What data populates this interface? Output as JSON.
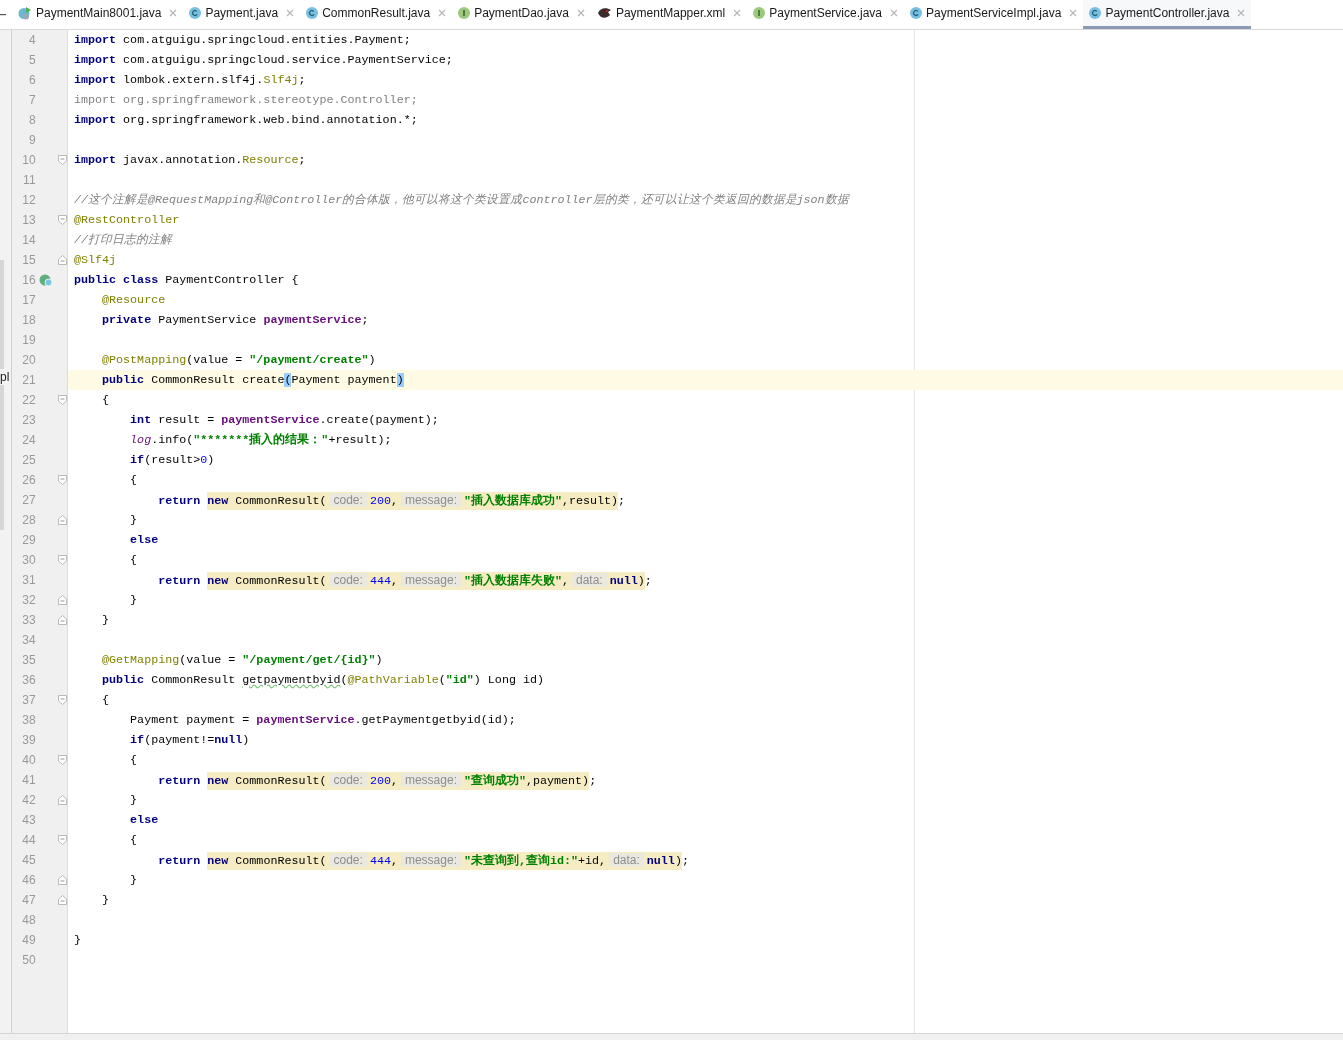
{
  "tab_bar": {
    "tabs": [
      {
        "label": "PaymentMain8001.java",
        "kind": "main",
        "selected": false
      },
      {
        "label": "Payment.java",
        "kind": "class",
        "selected": false
      },
      {
        "label": "CommonResult.java",
        "kind": "class",
        "selected": false
      },
      {
        "label": "PaymentDao.java",
        "kind": "interface",
        "selected": false
      },
      {
        "label": "PaymentMapper.xml",
        "kind": "mapper",
        "selected": false
      },
      {
        "label": "PaymentService.java",
        "kind": "interface",
        "selected": false
      },
      {
        "label": "PaymentServiceImpl.java",
        "kind": "class",
        "selected": false
      },
      {
        "label": "PaymentController.java",
        "kind": "class",
        "selected": true
      }
    ]
  },
  "side_panel": {
    "text": "pl"
  },
  "editor": {
    "lines": [
      {
        "number": "4",
        "current": false,
        "tokens": [
          {
            "kind": "kw",
            "text": "import"
          },
          {
            "kind": "plain",
            "text": " com.atguigu.springcloud.entities.Payment;"
          }
        ]
      },
      {
        "number": "5",
        "current": false,
        "tokens": [
          {
            "kind": "kw",
            "text": "import"
          },
          {
            "kind": "plain",
            "text": " com.atguigu.springcloud.service.PaymentService;"
          }
        ]
      },
      {
        "number": "6",
        "current": false,
        "tokens": [
          {
            "kind": "kw",
            "text": "import"
          },
          {
            "kind": "plain",
            "text": " lombok.extern.slf4j."
          },
          {
            "kind": "ann",
            "text": "Slf4j"
          },
          {
            "kind": "plain",
            "text": ";"
          }
        ]
      },
      {
        "number": "7",
        "current": false,
        "tokens": [
          {
            "kind": "unused",
            "text": "import org.springframework.stereotype.Controller;"
          }
        ]
      },
      {
        "number": "8",
        "current": false,
        "tokens": [
          {
            "kind": "kw",
            "text": "import"
          },
          {
            "kind": "plain",
            "text": " org.springframework.web.bind.annotation.*;"
          }
        ]
      },
      {
        "number": "9",
        "current": false
      },
      {
        "number": "10",
        "current": false,
        "fold": {
          "kind": "start"
        },
        "tokens": [
          {
            "kind": "kw",
            "text": "import"
          },
          {
            "kind": "plain",
            "text": " javax.annotation."
          },
          {
            "kind": "ann",
            "text": "Resource"
          },
          {
            "kind": "plain",
            "text": ";"
          }
        ]
      },
      {
        "number": "11",
        "current": false
      },
      {
        "number": "12",
        "current": false,
        "tokens": [
          {
            "kind": "comment",
            "text": "//这个注解是@RequestMapping和@Controller的合体版，他可以将这个类设置成controller层的类，还可以让这个类返回的数据是json数据"
          }
        ]
      },
      {
        "number": "13",
        "current": false,
        "fold": {
          "kind": "start"
        },
        "tokens": [
          {
            "kind": "ann",
            "text": "@RestController"
          }
        ]
      },
      {
        "number": "14",
        "current": false,
        "tokens": [
          {
            "kind": "comment",
            "text": "//打印日志的注解"
          }
        ]
      },
      {
        "number": "15",
        "current": false,
        "fold": {
          "kind": "end"
        },
        "tokens": [
          {
            "kind": "ann",
            "text": "@Slf4j"
          }
        ]
      },
      {
        "number": "16",
        "current": false,
        "gutter_icon": {
          "kind": "run"
        },
        "tokens": [
          {
            "kind": "kw",
            "text": "public class"
          },
          {
            "kind": "plain",
            "text": " PaymentController {"
          }
        ]
      },
      {
        "number": "17",
        "current": false,
        "tokens": [
          {
            "kind": "ann",
            "text": "    @Resource"
          }
        ]
      },
      {
        "number": "18",
        "current": false,
        "tokens": [
          {
            "kind": "kw",
            "text": "    private"
          },
          {
            "kind": "plain",
            "text": " PaymentService "
          },
          {
            "kind": "field",
            "text": "paymentService"
          },
          {
            "kind": "plain",
            "text": ";"
          }
        ]
      },
      {
        "number": "19",
        "current": false
      },
      {
        "number": "20",
        "current": false,
        "tokens": [
          {
            "kind": "ann",
            "text": "    @PostMapping"
          },
          {
            "kind": "plain",
            "text": "(value = "
          },
          {
            "kind": "str",
            "text": "\"/payment/create\""
          },
          {
            "kind": "plain",
            "text": ")"
          }
        ]
      },
      {
        "number": "21",
        "current": true,
        "tokens": [
          {
            "kind": "kw",
            "text": "    public"
          },
          {
            "kind": "plain",
            "text": " CommonResult create"
          },
          {
            "kind": "match",
            "text": "("
          },
          {
            "kind": "plain",
            "text": "Payment payment"
          },
          {
            "kind": "match",
            "text": ")"
          }
        ]
      },
      {
        "number": "22",
        "current": false,
        "fold": {
          "kind": "start"
        },
        "tokens": [
          {
            "kind": "plain",
            "text": "    {"
          }
        ]
      },
      {
        "number": "23",
        "current": false,
        "tokens": [
          {
            "kind": "kw",
            "text": "        int"
          },
          {
            "kind": "plain",
            "text": " result = "
          },
          {
            "kind": "field",
            "text": "paymentService"
          },
          {
            "kind": "plain",
            "text": ".create(payment);"
          }
        ]
      },
      {
        "number": "24",
        "current": false,
        "tokens": [
          {
            "kind": "static",
            "text": "        log"
          },
          {
            "kind": "plain",
            "text": ".info("
          },
          {
            "kind": "str",
            "text": "\"*******插入的结果：\""
          },
          {
            "kind": "plain",
            "text": "+result);"
          }
        ]
      },
      {
        "number": "25",
        "current": false,
        "tokens": [
          {
            "kind": "kw",
            "text": "        if"
          },
          {
            "kind": "plain",
            "text": "(result>"
          },
          {
            "kind": "num",
            "text": "0"
          },
          {
            "kind": "plain",
            "text": ")"
          }
        ]
      },
      {
        "number": "26",
        "current": false,
        "fold": {
          "kind": "start"
        },
        "tokens": [
          {
            "kind": "plain",
            "text": "        {"
          }
        ]
      },
      {
        "number": "27",
        "current": false,
        "tokens": [
          {
            "kind": "kw",
            "text": "            return "
          },
          {
            "kind": "highlight",
            "tokens": [
              {
                "kind": "kw",
                "text": "new"
              },
              {
                "kind": "plain",
                "text": " CommonResult("
              },
              {
                "kind": "hint",
                "text": "code:"
              },
              {
                "kind": "num",
                "text": "200"
              },
              {
                "kind": "plain",
                "text": ","
              },
              {
                "kind": "hint",
                "text": "message:"
              },
              {
                "kind": "str",
                "text": "\"插入数据库成功\""
              },
              {
                "kind": "plain",
                "text": ",result)"
              }
            ]
          },
          {
            "kind": "plain",
            "text": ";"
          }
        ]
      },
      {
        "number": "28",
        "current": false,
        "fold": {
          "kind": "end"
        },
        "tokens": [
          {
            "kind": "plain",
            "text": "        }"
          }
        ]
      },
      {
        "number": "29",
        "current": false,
        "tokens": [
          {
            "kind": "kw",
            "text": "        else"
          }
        ]
      },
      {
        "number": "30",
        "current": false,
        "fold": {
          "kind": "start"
        },
        "tokens": [
          {
            "kind": "plain",
            "text": "        {"
          }
        ]
      },
      {
        "number": "31",
        "current": false,
        "tokens": [
          {
            "kind": "kw",
            "text": "            return "
          },
          {
            "kind": "highlight",
            "tokens": [
              {
                "kind": "kw",
                "text": "new"
              },
              {
                "kind": "plain",
                "text": " CommonResult("
              },
              {
                "kind": "hint",
                "text": "code:"
              },
              {
                "kind": "num",
                "text": "444"
              },
              {
                "kind": "plain",
                "text": ","
              },
              {
                "kind": "hint",
                "text": "message:"
              },
              {
                "kind": "str",
                "text": "\"插入数据库失败\""
              },
              {
                "kind": "plain",
                "text": ","
              },
              {
                "kind": "hint",
                "text": "data:"
              },
              {
                "kind": "kw",
                "text": "null"
              },
              {
                "kind": "plain",
                "text": ")"
              }
            ]
          },
          {
            "kind": "plain",
            "text": ";"
          }
        ]
      },
      {
        "number": "32",
        "current": false,
        "fold": {
          "kind": "end"
        },
        "tokens": [
          {
            "kind": "plain",
            "text": "        }"
          }
        ]
      },
      {
        "number": "33",
        "current": false,
        "fold": {
          "kind": "end"
        },
        "tokens": [
          {
            "kind": "plain",
            "text": "    }"
          }
        ]
      },
      {
        "number": "34",
        "current": false
      },
      {
        "number": "35",
        "current": false,
        "tokens": [
          {
            "kind": "ann",
            "text": "    @GetMapping"
          },
          {
            "kind": "plain",
            "text": "(value = "
          },
          {
            "kind": "str",
            "text": "\"/payment/get/{id}\""
          },
          {
            "kind": "plain",
            "text": ")"
          }
        ]
      },
      {
        "number": "36",
        "current": false,
        "tokens": [
          {
            "kind": "kw",
            "text": "    public"
          },
          {
            "kind": "plain",
            "text": " CommonResult "
          },
          {
            "kind": "typo",
            "text": "getpaymentbyid"
          },
          {
            "kind": "plain",
            "text": "("
          },
          {
            "kind": "ann",
            "text": "@PathVariable"
          },
          {
            "kind": "plain",
            "text": "("
          },
          {
            "kind": "str",
            "text": "\"id\""
          },
          {
            "kind": "plain",
            "text": ") Long id)"
          }
        ]
      },
      {
        "number": "37",
        "current": false,
        "fold": {
          "kind": "start"
        },
        "tokens": [
          {
            "kind": "plain",
            "text": "    {"
          }
        ]
      },
      {
        "number": "38",
        "current": false,
        "tokens": [
          {
            "kind": "plain",
            "text": "        Payment payment = "
          },
          {
            "kind": "field",
            "text": "paymentService"
          },
          {
            "kind": "plain",
            "text": ".getPaymentgetbyid(id);"
          }
        ]
      },
      {
        "number": "39",
        "current": false,
        "tokens": [
          {
            "kind": "kw",
            "text": "        if"
          },
          {
            "kind": "plain",
            "text": "(payment!="
          },
          {
            "kind": "kw",
            "text": "null"
          },
          {
            "kind": "plain",
            "text": ")"
          }
        ]
      },
      {
        "number": "40",
        "current": false,
        "fold": {
          "kind": "start"
        },
        "tokens": [
          {
            "kind": "plain",
            "text": "        {"
          }
        ]
      },
      {
        "number": "41",
        "current": false,
        "tokens": [
          {
            "kind": "kw",
            "text": "            return "
          },
          {
            "kind": "highlight",
            "tokens": [
              {
                "kind": "kw",
                "text": "new"
              },
              {
                "kind": "plain",
                "text": " CommonResult("
              },
              {
                "kind": "hint",
                "text": "code:"
              },
              {
                "kind": "num",
                "text": "200"
              },
              {
                "kind": "plain",
                "text": ","
              },
              {
                "kind": "hint",
                "text": "message:"
              },
              {
                "kind": "str",
                "text": "\"查询成功\""
              },
              {
                "kind": "plain",
                "text": ",payment)"
              }
            ]
          },
          {
            "kind": "plain",
            "text": ";"
          }
        ]
      },
      {
        "number": "42",
        "current": false,
        "fold": {
          "kind": "end"
        },
        "tokens": [
          {
            "kind": "plain",
            "text": "        }"
          }
        ]
      },
      {
        "number": "43",
        "current": false,
        "tokens": [
          {
            "kind": "kw",
            "text": "        else"
          }
        ]
      },
      {
        "number": "44",
        "current": false,
        "fold": {
          "kind": "start"
        },
        "tokens": [
          {
            "kind": "plain",
            "text": "        {"
          }
        ]
      },
      {
        "number": "45",
        "current": false,
        "tokens": [
          {
            "kind": "kw",
            "text": "            return "
          },
          {
            "kind": "highlight",
            "tokens": [
              {
                "kind": "kw",
                "text": "new"
              },
              {
                "kind": "plain",
                "text": " CommonResult("
              },
              {
                "kind": "hint",
                "text": "code:"
              },
              {
                "kind": "num",
                "text": "444"
              },
              {
                "kind": "plain",
                "text": ","
              },
              {
                "kind": "hint",
                "text": "message:"
              },
              {
                "kind": "str",
                "text": "\"未查询到,查询id:\""
              },
              {
                "kind": "plain",
                "text": "+id,"
              },
              {
                "kind": "hint",
                "text": "data:"
              },
              {
                "kind": "kw",
                "text": "null"
              },
              {
                "kind": "plain",
                "text": ")"
              }
            ]
          },
          {
            "kind": "plain",
            "text": ";"
          }
        ]
      },
      {
        "number": "46",
        "current": false,
        "fold": {
          "kind": "end"
        },
        "tokens": [
          {
            "kind": "plain",
            "text": "        }"
          }
        ]
      },
      {
        "number": "47",
        "current": false,
        "fold": {
          "kind": "end"
        },
        "tokens": [
          {
            "kind": "plain",
            "text": "    }"
          }
        ]
      },
      {
        "number": "48",
        "current": false
      },
      {
        "number": "49",
        "current": false,
        "tokens": [
          {
            "kind": "plain",
            "text": "}"
          }
        ]
      },
      {
        "number": "50",
        "current": false
      }
    ]
  }
}
